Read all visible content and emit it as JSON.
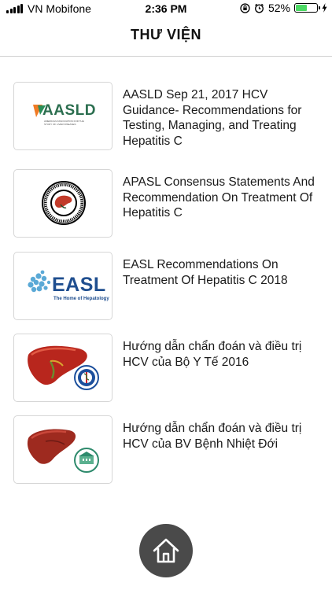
{
  "status_bar": {
    "carrier": "VN Mobifone",
    "time": "2:36 PM",
    "battery_text": "52%",
    "battery_level": 0.52,
    "battery_color": "#4cd964"
  },
  "nav": {
    "title": "THƯ VIỆN"
  },
  "library": {
    "items": [
      {
        "title": "AASLD Sep 21, 2017 HCV Guidance- Recommendations for Testing, Managing, and Treating Hepatitis C",
        "thumbnail": "aasld-logo"
      },
      {
        "title": "APASL Consensus Statements And Recommendation On Treatment Of Hepatitis C",
        "thumbnail": "apasl-seal"
      },
      {
        "title": "EASL Recommendations On Treatment Of Hepatitis C 2018",
        "thumbnail": "easl-logo"
      },
      {
        "title": "Hướng dẫn chẩn đoán và điều trị HCV của Bộ Y Tế 2016",
        "thumbnail": "liver-moh-emblem"
      },
      {
        "title": "Hướng dẫn chẩn đoán và điều trị HCV của BV Bệnh Nhiệt Đới",
        "thumbnail": "liver-hospital-emblem"
      }
    ]
  },
  "logos": {
    "aasld": {
      "wordmark": "AASLD",
      "subtitle": "AMERICAN ASSOCIATION FOR THE STUDY OF LIVER DISEASES"
    },
    "easl": {
      "wordmark": "EASL",
      "tagline": "The Home of Hepatology"
    }
  },
  "home_button": {
    "icon": "home-icon",
    "color": "#4a4a4a"
  }
}
